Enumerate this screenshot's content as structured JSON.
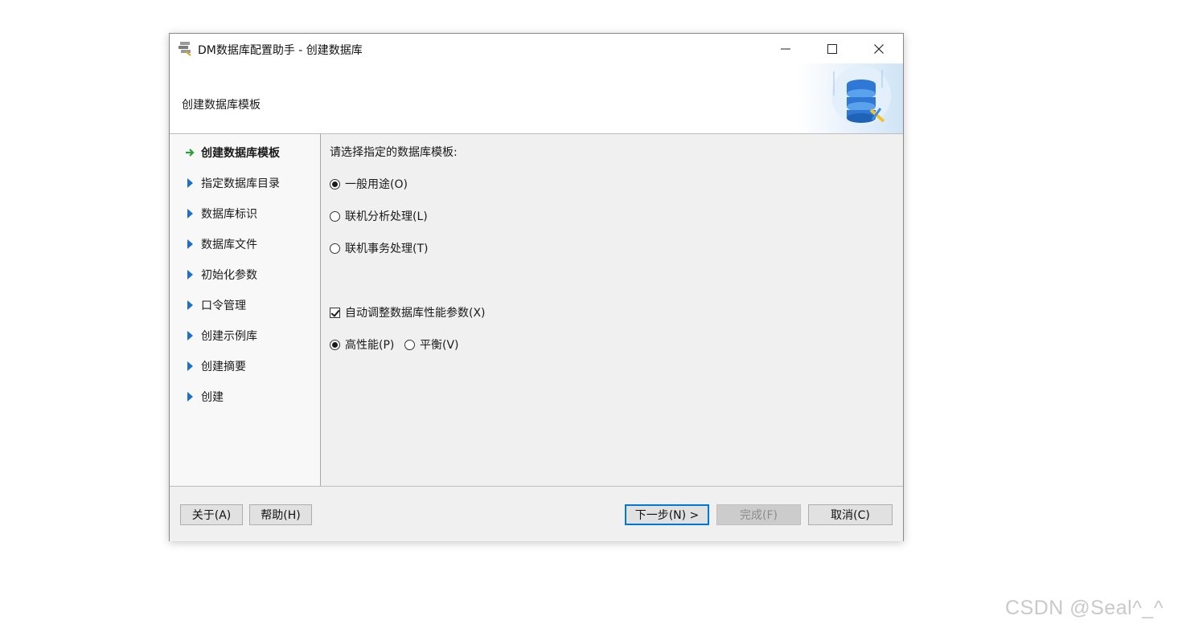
{
  "window": {
    "title": "DM数据库配置助手 - 创建数据库",
    "buttons": {
      "minimize": "minimize-icon",
      "maximize": "maximize-icon",
      "close": "close-icon"
    }
  },
  "header": {
    "title": "创建数据库模板"
  },
  "sidebar": {
    "steps": [
      {
        "label": "创建数据库模板",
        "current": true
      },
      {
        "label": "指定数据库目录"
      },
      {
        "label": "数据库标识"
      },
      {
        "label": "数据库文件"
      },
      {
        "label": "初始化参数"
      },
      {
        "label": "口令管理"
      },
      {
        "label": "创建示例库"
      },
      {
        "label": "创建摘要"
      },
      {
        "label": "创建"
      }
    ]
  },
  "content": {
    "prompt": "请选择指定的数据库模板:",
    "templates": [
      {
        "label": "一般用途(O)",
        "checked": true
      },
      {
        "label": "联机分析处理(L)",
        "checked": false
      },
      {
        "label": "联机事务处理(T)",
        "checked": false
      }
    ],
    "auto_tune": {
      "label": "自动调整数据库性能参数(X)",
      "checked": true
    },
    "perf_modes": [
      {
        "label": "高性能(P)",
        "checked": true
      },
      {
        "label": "平衡(V)",
        "checked": false
      }
    ]
  },
  "footer": {
    "about": "关于(A)",
    "help": "帮助(H)",
    "next": "下一步(N) >",
    "finish": "完成(F)",
    "cancel": "取消(C)"
  },
  "watermark": "CSDN @Seal^_^",
  "colors": {
    "accent": "#0078d7",
    "step_arrow": "#1f6fc8",
    "current_arrow": "#2e9e3a"
  }
}
